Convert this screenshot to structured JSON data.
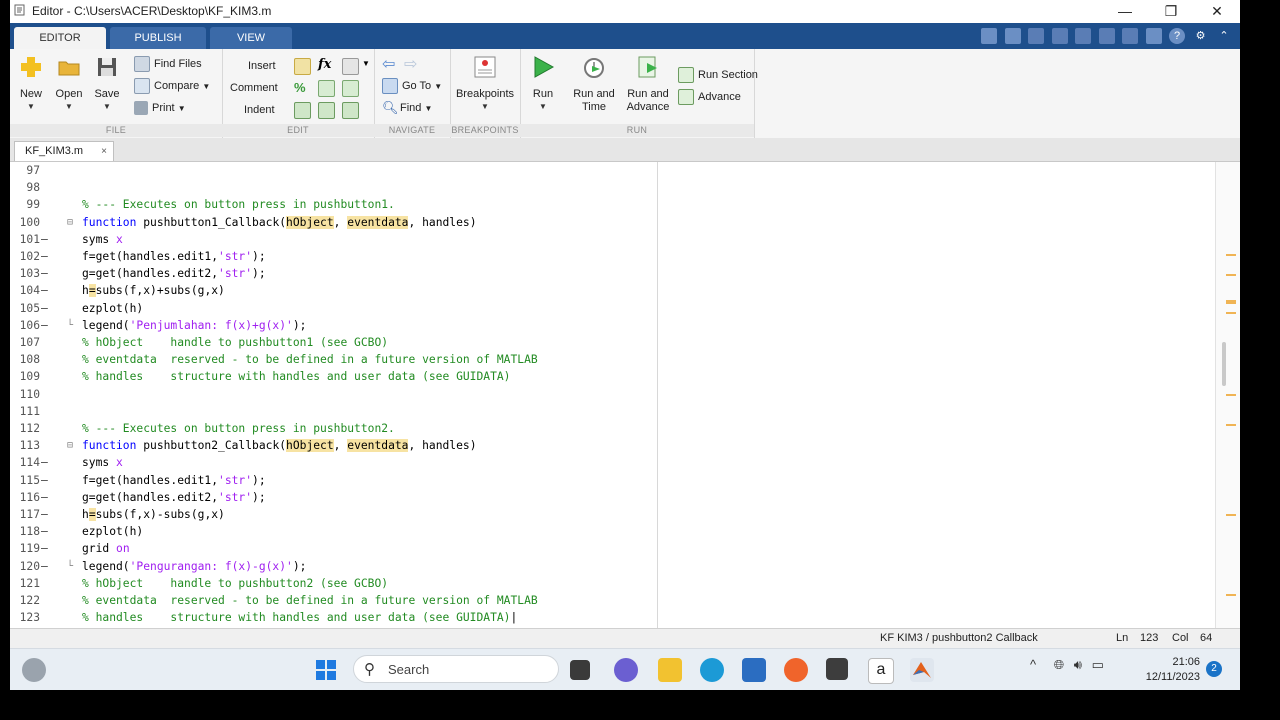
{
  "window": {
    "title": "Editor - C:\\Users\\ACER\\Desktop\\KF_KIM3.m",
    "controls": [
      "—",
      "❐",
      "✕"
    ]
  },
  "ribbon_tabs": [
    "EDITOR",
    "PUBLISH",
    "VIEW"
  ],
  "ribbon": {
    "file": {
      "label": "FILE",
      "new": "New",
      "open": "Open",
      "save": "Save",
      "find_files": "Find Files",
      "compare": "Compare",
      "print": "Print"
    },
    "edit": {
      "label": "EDIT",
      "insert": "Insert",
      "comment": "Comment",
      "indent": "Indent",
      "fx": "fx"
    },
    "navigate": {
      "label": "NAVIGATE",
      "go_to": "Go To",
      "find": "Find"
    },
    "breakpoints": {
      "label": "BREAKPOINTS",
      "button": "Breakpoints"
    },
    "run": {
      "label": "RUN",
      "run": "Run",
      "run_and_time_1": "Run and",
      "run_and_time_2": "Time",
      "run_and_advance_1": "Run and",
      "run_and_advance_2": "Advance",
      "run_section": "Run Section",
      "advance": "Advance"
    }
  },
  "doc_tab": {
    "name": "KF_KIM3.m",
    "close": "×"
  },
  "lines": [
    {
      "n": "97",
      "bp": "",
      "fold": "",
      "parts": []
    },
    {
      "n": "98",
      "bp": "",
      "fold": "",
      "parts": []
    },
    {
      "n": "99",
      "bp": "",
      "fold": "",
      "parts": [
        {
          "t": "% --- Executes on button press in pushbutton1.",
          "c": "com"
        }
      ]
    },
    {
      "n": "100",
      "bp": "",
      "fold": "⊟",
      "parts": [
        {
          "t": "function ",
          "c": "kw"
        },
        {
          "t": "pushbutton1_Callback(",
          "c": "txt"
        },
        {
          "t": "hObject",
          "c": "hl"
        },
        {
          "t": ", ",
          "c": "txt"
        },
        {
          "t": "eventdata",
          "c": "hl"
        },
        {
          "t": ", handles)",
          "c": "txt"
        }
      ]
    },
    {
      "n": "101",
      "bp": "—",
      "fold": "",
      "parts": [
        {
          "t": "syms ",
          "c": "txt"
        },
        {
          "t": "x",
          "c": "str"
        }
      ]
    },
    {
      "n": "102",
      "bp": "—",
      "fold": "",
      "parts": [
        {
          "t": "f=get(handles.edit1,",
          "c": "txt"
        },
        {
          "t": "'str'",
          "c": "str"
        },
        {
          "t": ");",
          "c": "txt"
        }
      ]
    },
    {
      "n": "103",
      "bp": "—",
      "fold": "",
      "parts": [
        {
          "t": "g=get(handles.edit2,",
          "c": "txt"
        },
        {
          "t": "'str'",
          "c": "str"
        },
        {
          "t": ");",
          "c": "txt"
        }
      ]
    },
    {
      "n": "104",
      "bp": "—",
      "fold": "",
      "parts": [
        {
          "t": "h",
          "c": "txt"
        },
        {
          "t": "=",
          "c": "hl"
        },
        {
          "t": "subs(f,x)+subs(g,x)",
          "c": "txt"
        }
      ]
    },
    {
      "n": "105",
      "bp": "—",
      "fold": "",
      "parts": [
        {
          "t": "ezplot(h)",
          "c": "txt"
        }
      ]
    },
    {
      "n": "106",
      "bp": "—",
      "fold": "└",
      "parts": [
        {
          "t": "legend(",
          "c": "txt"
        },
        {
          "t": "'Penjumlahan: f(x)+g(x)'",
          "c": "str"
        },
        {
          "t": ");",
          "c": "txt"
        }
      ]
    },
    {
      "n": "107",
      "bp": "",
      "fold": "",
      "parts": [
        {
          "t": "% hObject    handle to pushbutton1 (see GCBO)",
          "c": "com"
        }
      ]
    },
    {
      "n": "108",
      "bp": "",
      "fold": "",
      "parts": [
        {
          "t": "% eventdata  reserved - to be defined in a future version of MATLAB",
          "c": "com"
        }
      ]
    },
    {
      "n": "109",
      "bp": "",
      "fold": "",
      "parts": [
        {
          "t": "% handles    structure with handles and user data (see GUIDATA)",
          "c": "com"
        }
      ]
    },
    {
      "n": "110",
      "bp": "",
      "fold": "",
      "parts": []
    },
    {
      "n": "111",
      "bp": "",
      "fold": "",
      "parts": []
    },
    {
      "n": "112",
      "bp": "",
      "fold": "",
      "parts": [
        {
          "t": "% --- Executes on button press in pushbutton2.",
          "c": "com"
        }
      ]
    },
    {
      "n": "113",
      "bp": "",
      "fold": "⊟",
      "parts": [
        {
          "t": "function ",
          "c": "kw"
        },
        {
          "t": "pushbutton2_Callback(",
          "c": "txt"
        },
        {
          "t": "hObject",
          "c": "hl"
        },
        {
          "t": ", ",
          "c": "txt"
        },
        {
          "t": "eventdata",
          "c": "hl"
        },
        {
          "t": ", handles)",
          "c": "txt"
        }
      ]
    },
    {
      "n": "114",
      "bp": "—",
      "fold": "",
      "parts": [
        {
          "t": "syms ",
          "c": "txt"
        },
        {
          "t": "x",
          "c": "str"
        }
      ]
    },
    {
      "n": "115",
      "bp": "—",
      "fold": "",
      "parts": [
        {
          "t": "f=get(handles.edit1,",
          "c": "txt"
        },
        {
          "t": "'str'",
          "c": "str"
        },
        {
          "t": ");",
          "c": "txt"
        }
      ]
    },
    {
      "n": "116",
      "bp": "—",
      "fold": "",
      "parts": [
        {
          "t": "g=get(handles.edit2,",
          "c": "txt"
        },
        {
          "t": "'str'",
          "c": "str"
        },
        {
          "t": ");",
          "c": "txt"
        }
      ]
    },
    {
      "n": "117",
      "bp": "—",
      "fold": "",
      "parts": [
        {
          "t": "h",
          "c": "txt"
        },
        {
          "t": "=",
          "c": "hl"
        },
        {
          "t": "subs(f,x)-subs(g,x)",
          "c": "txt"
        }
      ]
    },
    {
      "n": "118",
      "bp": "—",
      "fold": "",
      "parts": [
        {
          "t": "ezplot(h)",
          "c": "txt"
        }
      ]
    },
    {
      "n": "119",
      "bp": "—",
      "fold": "",
      "parts": [
        {
          "t": "grid ",
          "c": "txt"
        },
        {
          "t": "on",
          "c": "str"
        }
      ]
    },
    {
      "n": "120",
      "bp": "—",
      "fold": "└",
      "parts": [
        {
          "t": "legend(",
          "c": "txt"
        },
        {
          "t": "'Pengurangan: f(x)-g(x)'",
          "c": "str"
        },
        {
          "t": ");",
          "c": "txt"
        }
      ]
    },
    {
      "n": "121",
      "bp": "",
      "fold": "",
      "parts": [
        {
          "t": "% hObject    handle to pushbutton2 (see GCBO)",
          "c": "com"
        }
      ]
    },
    {
      "n": "122",
      "bp": "",
      "fold": "",
      "parts": [
        {
          "t": "% eventdata  reserved - to be defined in a future version of MATLAB",
          "c": "com"
        }
      ]
    },
    {
      "n": "123",
      "bp": "",
      "fold": "",
      "parts": [
        {
          "t": "% handles    structure with handles and user data (see GUIDATA)",
          "c": "com"
        },
        {
          "t": "|",
          "c": "txt"
        }
      ]
    }
  ],
  "status": {
    "context": "KF KIM3 / pushbutton2 Callback",
    "ln_label": "Ln",
    "ln": "123",
    "col_label": "Col",
    "col": "64"
  },
  "taskbar": {
    "search_placeholder": "Search",
    "time": "21:06",
    "date": "12/11/2023",
    "notifications": "2",
    "tray_caret": "^"
  },
  "colors": {
    "ribbon_blue": "#1e4f8c",
    "comment": "#228b22",
    "keyword": "#0000ff",
    "string": "#a020f0",
    "highlight": "#f7e3a3"
  }
}
